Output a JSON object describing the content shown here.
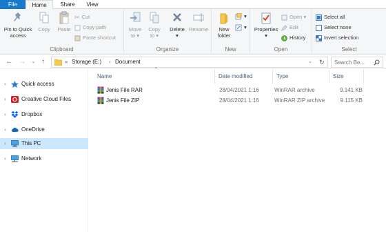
{
  "tabs": {
    "file": "File",
    "home": "Home",
    "share": "Share",
    "view": "View"
  },
  "ribbon": {
    "clipboard": {
      "label": "Clipboard",
      "pin_line1": "Pin to Quick",
      "pin_line2": "access",
      "copy": "Copy",
      "paste": "Paste",
      "cut": "Cut",
      "copy_path": "Copy path",
      "paste_shortcut": "Paste shortcut"
    },
    "organize": {
      "label": "Organize",
      "move_line1": "Move",
      "move_line2": "to",
      "copy_line1": "Copy",
      "copy_line2": "to",
      "delete": "Delete",
      "rename": "Rename"
    },
    "new": {
      "label": "New",
      "folder_line1": "New",
      "folder_line2": "folder"
    },
    "open": {
      "label": "Open",
      "properties": "Properties",
      "open": "Open",
      "edit": "Edit",
      "history": "History"
    },
    "select": {
      "label": "Select",
      "select_all": "Select all",
      "select_none": "Select none",
      "invert": "Invert selection"
    }
  },
  "address": {
    "prefix": "«",
    "crumbs": [
      "Storage (E:)",
      "Document"
    ],
    "separator": "›",
    "search_placeholder": "Search Be..."
  },
  "nav": {
    "items": [
      {
        "label": "Quick access",
        "icon": "star-icon"
      },
      {
        "label": "Creative Cloud Files",
        "icon": "creative-cloud-icon"
      },
      {
        "label": "Dropbox",
        "icon": "dropbox-icon"
      },
      {
        "label": "OneDrive",
        "icon": "cloud-icon"
      },
      {
        "label": "This PC",
        "icon": "computer-icon",
        "selected": true
      },
      {
        "label": "Network",
        "icon": "network-icon"
      }
    ]
  },
  "columns": {
    "name": "Name",
    "date": "Date modified",
    "type": "Type",
    "size": "Size"
  },
  "files": [
    {
      "name": "Jenis File RAR",
      "date": "28/04/2021 1:16",
      "type": "WinRAR archive",
      "size": "9.141 KB"
    },
    {
      "name": "Jenis File ZIP",
      "date": "28/04/2021 1:16",
      "type": "WinRAR ZIP archive",
      "size": "9.115 KB"
    }
  ],
  "colors": {
    "accent": "#1979ca",
    "selection": "#cce8ff"
  }
}
